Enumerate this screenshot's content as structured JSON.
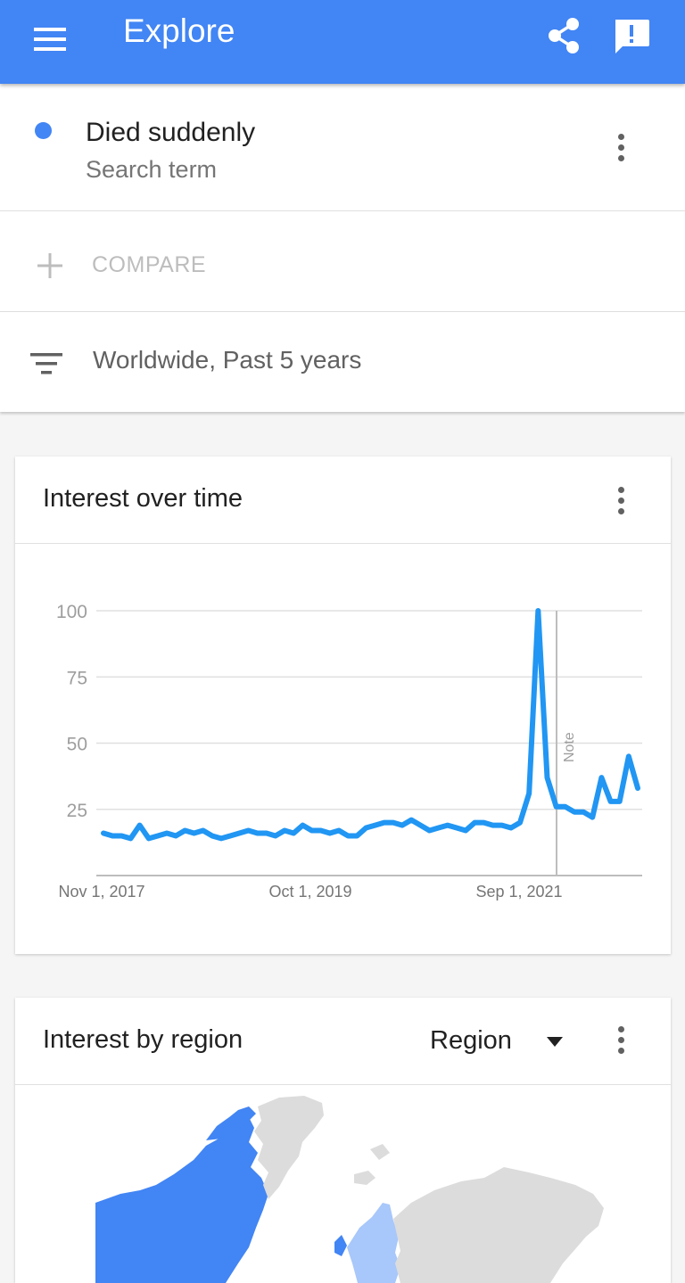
{
  "appbar": {
    "title": "Explore",
    "icons": [
      "menu-icon",
      "share-icon",
      "feedback-icon"
    ],
    "color": "#4285f4"
  },
  "search_term": {
    "name": "Died suddenly",
    "type": "Search term",
    "dot_color": "#4285f4"
  },
  "compare": {
    "label": "COMPARE"
  },
  "filter": {
    "label": "Worldwide, Past 5 years"
  },
  "interest_over_time": {
    "title": "Interest over time"
  },
  "interest_by_region": {
    "title": "Interest by region",
    "select_value": "Region"
  },
  "chart_data": {
    "type": "line",
    "title": "",
    "xlabel": "",
    "ylabel": "",
    "ylim": [
      0,
      100
    ],
    "yticks": [
      25,
      50,
      75,
      100
    ],
    "xticks": [
      "Nov 1, 2017",
      "Oct 1, 2019",
      "Sep 1, 2021"
    ],
    "annotations": [
      "Note"
    ],
    "grid": true,
    "line_color": "#2196f3",
    "series": [
      {
        "values": [
          16,
          15,
          15,
          14,
          19,
          14,
          15,
          16,
          15,
          17,
          16,
          17,
          15,
          14,
          15,
          16,
          17,
          16,
          16,
          15,
          17,
          16,
          19,
          17,
          17,
          16,
          17,
          15,
          15,
          18,
          19,
          20,
          20,
          19,
          21,
          19,
          17,
          18,
          19,
          18,
          17,
          20,
          20,
          19,
          19,
          18,
          20,
          31,
          100,
          37,
          26,
          26,
          24,
          24,
          22,
          37,
          28,
          28,
          45,
          33
        ]
      }
    ]
  }
}
